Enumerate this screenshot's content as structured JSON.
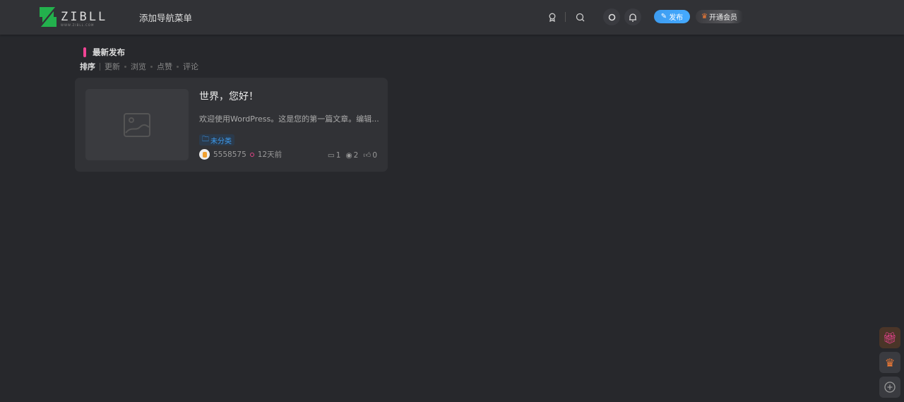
{
  "header": {
    "logo_text": "ZIBLL",
    "logo_sub": "WWW.ZIBLL.COM",
    "nav_menu": "添加导航菜单",
    "publish": "发布",
    "vip": "开通会员"
  },
  "section": {
    "title": "最新发布",
    "sort_label": "排序",
    "sort_options": [
      "更新",
      "浏览",
      "点赞",
      "评论"
    ]
  },
  "post": {
    "title": "世界，您好！",
    "excerpt": "欢迎使用WordPress。这是您的第一篇文章。编辑...",
    "category": "未分类",
    "author": "5558575",
    "time": "12天前",
    "comments": "1",
    "views": "2",
    "likes": "0"
  },
  "colors": {
    "accent": "#3d9cf0",
    "pink": "#f04494",
    "brand_green": "#23b14d"
  }
}
